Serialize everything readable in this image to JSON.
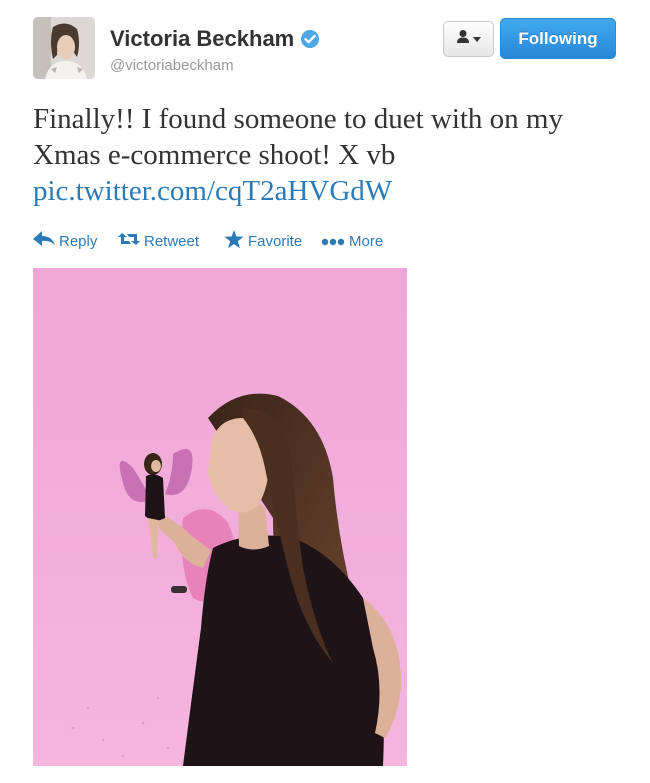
{
  "user": {
    "display_name": "Victoria Beckham",
    "screen_name": "@victoriabeckham",
    "verified": true
  },
  "follow_button": {
    "label": "Following"
  },
  "user_dropdown": {
    "icon": "person-icon",
    "caret": "caret-down-icon"
  },
  "tweet": {
    "text": "Finally!! I found someone to duet with on my Xmas e-commerce shoot! X vb",
    "link": "pic.twitter.com/cqT2aHVGdW"
  },
  "actions": {
    "reply": "Reply",
    "retweet": "Retweet",
    "favorite": "Favorite",
    "more": "More"
  },
  "colors": {
    "link_blue": "#2b7bb9",
    "button_blue": "#2f93e0",
    "photo_backdrop_pink": "#f1a9d8"
  }
}
